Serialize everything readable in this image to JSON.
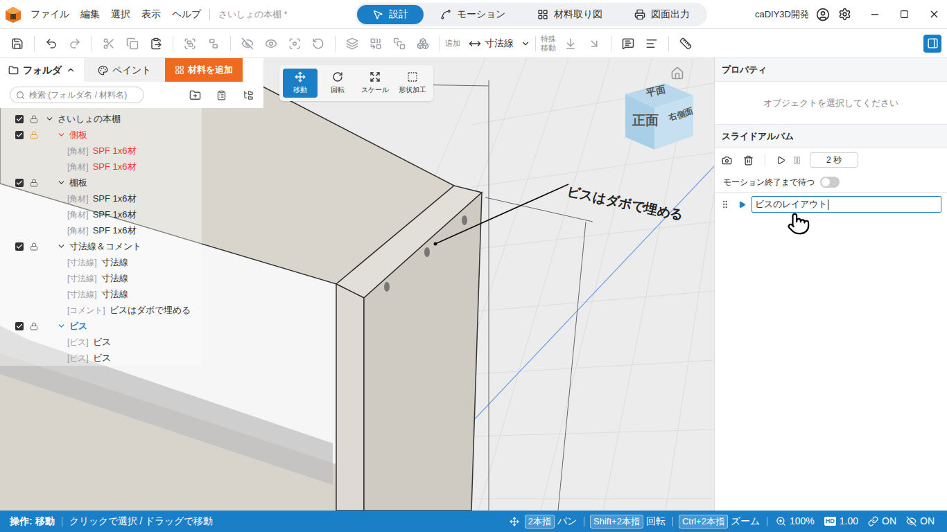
{
  "app": {
    "title": "さいしょの本棚 *",
    "account": "caDIY3D開発"
  },
  "menu": [
    "ファイル",
    "編集",
    "選択",
    "表示",
    "ヘルプ"
  ],
  "modes": [
    {
      "label": "設計",
      "selected": true
    },
    {
      "label": "モーション",
      "selected": false
    },
    {
      "label": "材料取り図",
      "selected": false
    },
    {
      "label": "図面出力",
      "selected": false
    }
  ],
  "toolbar": {
    "add_label": "追加",
    "dimension": "寸法線",
    "special_move": [
      "特殊",
      "移動"
    ],
    "panel_open": true
  },
  "folder_panel": {
    "tabs": [
      {
        "label": "フォルダ",
        "selected": true
      },
      {
        "label": "ペイント",
        "selected": false
      }
    ],
    "add_button": "材料を追加",
    "search_placeholder": "検索 (フォルダ名 / 材料名)",
    "tree": [
      {
        "kind": "folder",
        "depth": 0,
        "tag": "",
        "label": "さいしょの本棚",
        "checked": true,
        "locked": false,
        "expanded": true,
        "selected": false,
        "color": "#333333"
      },
      {
        "kind": "folder",
        "depth": 1,
        "tag": "",
        "label": "側板",
        "checked": true,
        "locked": true,
        "expanded": true,
        "selected": false,
        "color": "#e53935"
      },
      {
        "kind": "item",
        "depth": 2,
        "tag": "[角材]",
        "label": "SPF 1x6材",
        "checked": true,
        "locked": true,
        "expanded": false,
        "selected": false,
        "color": "#e53935"
      },
      {
        "kind": "item",
        "depth": 2,
        "tag": "[角材]",
        "label": "SPF 1x6材",
        "checked": true,
        "locked": true,
        "expanded": false,
        "selected": false,
        "color": "#e53935"
      },
      {
        "kind": "folder",
        "depth": 1,
        "tag": "",
        "label": "棚板",
        "checked": true,
        "locked": false,
        "expanded": true,
        "selected": false,
        "color": "#333333"
      },
      {
        "kind": "item",
        "depth": 2,
        "tag": "[角材]",
        "label": "SPF 1x6材",
        "checked": true,
        "locked": false,
        "expanded": false,
        "selected": false,
        "color": "#333333"
      },
      {
        "kind": "item",
        "depth": 2,
        "tag": "[角材]",
        "label": "SPF 1x6材",
        "checked": true,
        "locked": false,
        "expanded": false,
        "selected": false,
        "color": "#333333"
      },
      {
        "kind": "item",
        "depth": 2,
        "tag": "[角材]",
        "label": "SPF 1x6材",
        "checked": true,
        "locked": false,
        "expanded": false,
        "selected": false,
        "color": "#333333"
      },
      {
        "kind": "folder",
        "depth": 1,
        "tag": "",
        "label": "寸法線＆コメント",
        "checked": true,
        "locked": false,
        "expanded": true,
        "selected": false,
        "color": "#333333"
      },
      {
        "kind": "item",
        "depth": 2,
        "tag": "[寸法線]",
        "label": "寸法線",
        "checked": true,
        "locked": false,
        "expanded": false,
        "selected": false,
        "color": "#333333"
      },
      {
        "kind": "item",
        "depth": 2,
        "tag": "[寸法線]",
        "label": "寸法線",
        "checked": true,
        "locked": false,
        "expanded": false,
        "selected": false,
        "color": "#333333"
      },
      {
        "kind": "item",
        "depth": 2,
        "tag": "[寸法線]",
        "label": "寸法線",
        "checked": true,
        "locked": false,
        "expanded": false,
        "selected": false,
        "color": "#333333"
      },
      {
        "kind": "item",
        "depth": 2,
        "tag": "[コメント]",
        "label": "ビスはダボで埋める",
        "checked": true,
        "locked": false,
        "expanded": false,
        "selected": false,
        "color": "#333333"
      },
      {
        "kind": "folder",
        "depth": 1,
        "tag": "",
        "label": "ビス",
        "checked": true,
        "locked": false,
        "expanded": true,
        "selected": true,
        "color": "#1a7fc7"
      },
      {
        "kind": "item",
        "depth": 2,
        "tag": "[ビス]",
        "label": "ビス",
        "checked": true,
        "locked": false,
        "expanded": false,
        "selected": false,
        "color": "#333333"
      },
      {
        "kind": "item",
        "depth": 2,
        "tag": "[ビス]",
        "label": "ビス",
        "checked": true,
        "locked": false,
        "expanded": false,
        "selected": false,
        "color": "#333333"
      }
    ]
  },
  "tools": [
    {
      "label": "移動",
      "selected": true
    },
    {
      "label": "回転",
      "selected": false
    },
    {
      "label": "スケール",
      "selected": false
    },
    {
      "label": "形状加工",
      "selected": false
    }
  ],
  "view_cube": {
    "top": "平面",
    "front": "正面",
    "right": "右側面"
  },
  "comment_label": "ビスはダボで埋める",
  "properties": {
    "title": "プロパティ",
    "empty": "オブジェクトを選択してください"
  },
  "slide_album": {
    "title": "スライドアルバム",
    "duration": "2 秒",
    "wait_label": "モーション終了まで待つ",
    "wait_on": false,
    "slides": [
      {
        "name": "ビスのレイアウト",
        "editing": true
      }
    ]
  },
  "status_bar": {
    "mode": "操作: 移動",
    "hint": "クリックで選択 / ドラッグで移動",
    "controls": [
      {
        "key": "2本指",
        "action": "パン"
      },
      {
        "key": "Shift+2本指",
        "action": "回転"
      },
      {
        "key": "Ctrl+2本指",
        "action": "ズーム"
      }
    ],
    "zoom": "100%",
    "hd_badge": "HD",
    "scale": "1.00",
    "link": "ON",
    "visibility": "ON"
  }
}
